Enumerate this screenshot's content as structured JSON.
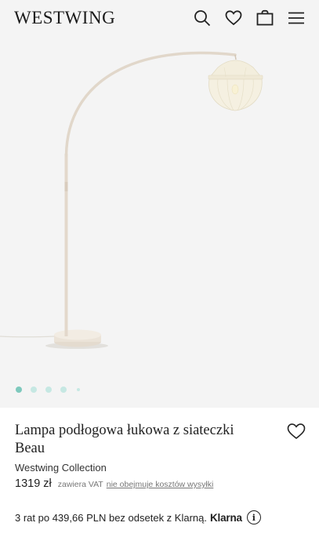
{
  "header": {
    "logo": "WESTWING",
    "icons": [
      "search-icon",
      "heart-icon",
      "bag-icon",
      "menu-icon"
    ]
  },
  "gallery": {
    "image_alt": "Lampa podłogowa łukowa z siateczki Beau",
    "slides_count": 5,
    "active_slide": 1
  },
  "product": {
    "title": "Lampa podłogowa łukowa z siateczki Beau",
    "brand": "Westwing Collection",
    "price": "1319 zł",
    "vat_note": "zawiera VAT",
    "shipping_note": "nie obejmuje kosztów wysyłki",
    "installments_text": "3 rat po 439,66 PLN bez odsetek z Klarną.",
    "klarna_logo": "Klarna",
    "info_icon": "i"
  },
  "colors": {
    "background": "#f4f4f4",
    "dot_active": "#7ec9bd",
    "dot_inactive": "#c6e8e3",
    "lamp_body": "#e6ddd2",
    "lampshade": "#f2eddb"
  }
}
